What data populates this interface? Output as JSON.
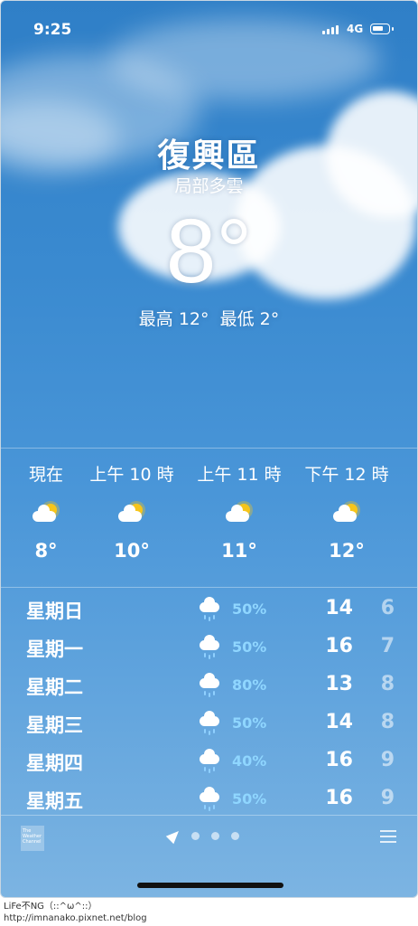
{
  "status": {
    "time": "9:25",
    "network": "4G"
  },
  "location": {
    "city": "復興區",
    "condition": "局部多雲",
    "temperature": "8°",
    "high_low": "最高 12°  最低 2°"
  },
  "hourly": [
    {
      "label": "現在",
      "icon": "partly-cloudy-day-icon",
      "temp": "8°"
    },
    {
      "label": "上午 10 時",
      "icon": "partly-cloudy-day-icon",
      "temp": "10°"
    },
    {
      "label": "上午 11 時",
      "icon": "partly-cloudy-day-icon",
      "temp": "11°"
    },
    {
      "label": "下午 12 時",
      "icon": "partly-cloudy-day-icon",
      "temp": "12°"
    }
  ],
  "daily": [
    {
      "day": "星期日",
      "icon": "rain-icon",
      "precip": "50%",
      "high": "14",
      "low": "6"
    },
    {
      "day": "星期一",
      "icon": "rain-icon",
      "precip": "50%",
      "high": "16",
      "low": "7"
    },
    {
      "day": "星期二",
      "icon": "rain-icon",
      "precip": "80%",
      "high": "13",
      "low": "8"
    },
    {
      "day": "星期三",
      "icon": "rain-icon",
      "precip": "50%",
      "high": "14",
      "low": "8"
    },
    {
      "day": "星期四",
      "icon": "rain-icon",
      "precip": "40%",
      "high": "16",
      "low": "9"
    },
    {
      "day": "星期五",
      "icon": "rain-icon",
      "precip": "50%",
      "high": "16",
      "low": "9"
    }
  ],
  "footer": {
    "logo_text": "The Weather Channel"
  },
  "watermark": {
    "line1": "LiFe不NG（::^ω^::）",
    "line2": "http://imnanako.pixnet.net/blog"
  }
}
